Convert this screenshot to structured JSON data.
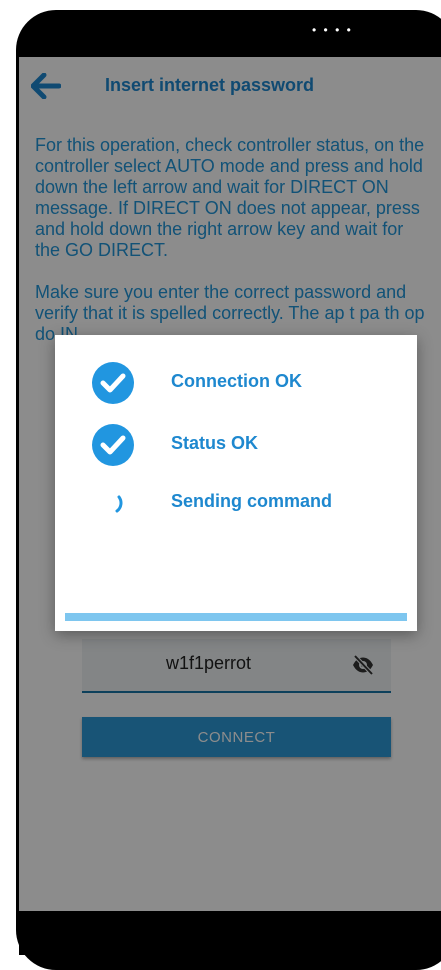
{
  "header": {
    "title": "Insert internet password",
    "back_icon": "arrow-left-icon"
  },
  "instructions": {
    "paragraph1": "For this operation, check controller status, on the controller select AUTO mode and press and hold down the left arrow and wait for DIRECT ON message. If DIRECT ON does not appear, press and hold down the right arrow key and wait for the GO DIRECT.",
    "paragraph2": "Make sure you enter the correct password and verify that it is spelled correctly. The ap                                     t pa th op do IN"
  },
  "password": {
    "value": "w1f1perrot",
    "visibility_icon": "eye-off-icon"
  },
  "connect_button": {
    "label": "CONNECT"
  },
  "dialog": {
    "steps": [
      {
        "label": "Connection OK",
        "status": "done",
        "icon": "check-circle-icon"
      },
      {
        "label": "Status OK",
        "status": "done",
        "icon": "check-circle-icon"
      },
      {
        "label": "Sending command",
        "status": "in-progress",
        "icon": "spinner-icon"
      }
    ],
    "progress": 1.0
  },
  "colors": {
    "accent": "#1e88cf",
    "button": "#2d9ad8",
    "progress": "#7ec6ef"
  }
}
